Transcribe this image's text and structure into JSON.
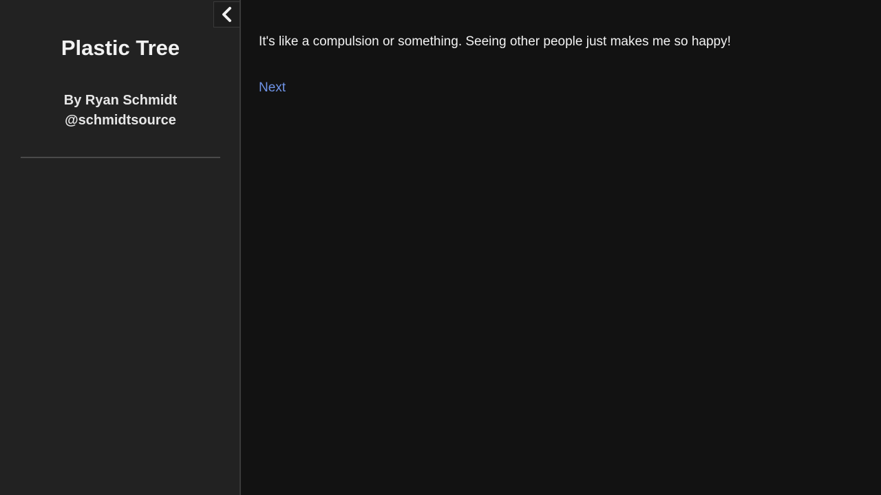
{
  "sidebar": {
    "title": "Plastic Tree",
    "author_line": "By Ryan Schmidt",
    "author_handle": "@schmidtsource",
    "collapse_icon": "chevron-left-icon"
  },
  "passage": {
    "text": "It's like a compulsion or something. Seeing other people just makes me so happy!",
    "links": [
      {
        "label": "Next"
      }
    ]
  },
  "colors": {
    "background": "#121212",
    "sidebar_background": "#222222",
    "text": "#f2f2f2",
    "link": "#6f93e6"
  }
}
